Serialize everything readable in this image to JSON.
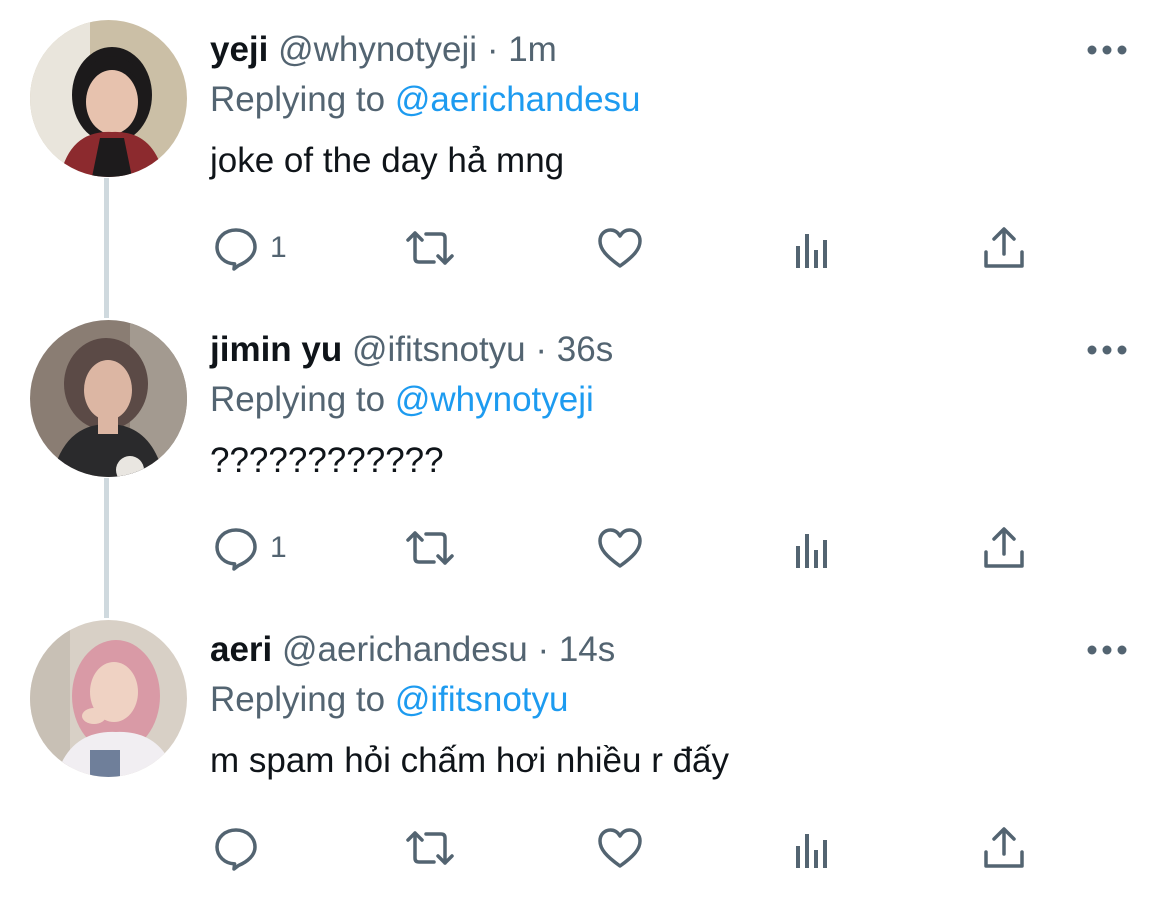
{
  "tweets": [
    {
      "display_name": "yeji",
      "handle": "@whynotyeji",
      "separator": "·",
      "time": "1m",
      "replying_prefix": "Replying to ",
      "replying_to": "@aerichandesu",
      "text": "joke of the day hả mng",
      "reply_count": "1",
      "avatar_colors": {
        "bg": "#cbbfa6",
        "hair": "#1c1a1b",
        "skin": "#e7c2ae",
        "top": "#8c2a2e"
      }
    },
    {
      "display_name": "jimin yu",
      "handle": "@ifitsnotyu",
      "separator": "·",
      "time": "36s",
      "replying_prefix": "Replying to ",
      "replying_to": "@whynotyeji",
      "text": "????????????",
      "reply_count": "1",
      "avatar_colors": {
        "bg": "#8a7d73",
        "hair": "#5b4a46",
        "skin": "#dcb6a3",
        "top": "#2a2a2c"
      }
    },
    {
      "display_name": "aeri",
      "handle": "@aerichandesu",
      "separator": "·",
      "time": "14s",
      "replying_prefix": "Replying to ",
      "replying_to": "@ifitsnotyu",
      "text": "m spam hỏi chấm hơi nhiều r đấy",
      "reply_count": "",
      "avatar_colors": {
        "bg": "#d8d0c6",
        "hair": "#d99aa6",
        "skin": "#efd2c3",
        "top": "#f1eef2"
      }
    }
  ],
  "icons": {
    "reply": "reply-icon",
    "retweet": "retweet-icon",
    "like": "like-icon",
    "analytics": "analytics-icon",
    "share": "share-icon",
    "more": "more-icon"
  },
  "colors": {
    "text": "#0f1419",
    "secondary": "#536471",
    "accent": "#1d9bf0",
    "thread_line": "#cfd9de"
  }
}
